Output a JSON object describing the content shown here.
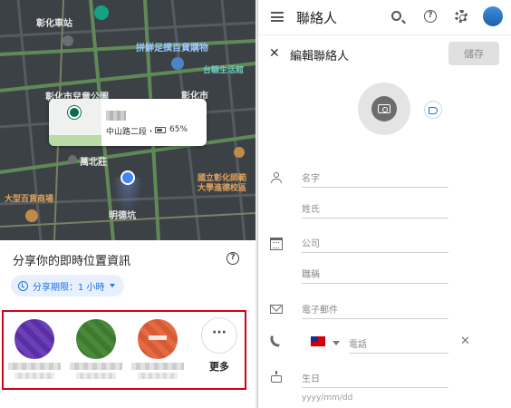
{
  "map": {
    "labels": {
      "changhua_station": "彰化車站",
      "shopping": "拼鮮足撲百貨購物",
      "taisugar": "台糖生活館",
      "children_park": "彰化市兒童公園",
      "changhua_city": "彰化市",
      "wanbei": "萬北莊",
      "university": "國立彰化師範大學進德校區",
      "minde": "明德坑",
      "mall": "大型百貨商場"
    },
    "card": {
      "address": "中山路二段・",
      "battery": "65%"
    }
  },
  "share": {
    "title": "分享你的即時位置資訊",
    "duration": "分享期限：1 小時",
    "more_label": "更多",
    "more_glyph": "···"
  },
  "contacts_app": {
    "title": "聯絡人",
    "edit_title": "編輯聯絡人",
    "save_label": "儲存",
    "close_glyph": "✕",
    "help_glyph": "?",
    "fields": {
      "first_name": "名字",
      "last_name": "姓氏",
      "company": "公司",
      "job_title": "職稱",
      "email": "電子郵件",
      "phone": "電話",
      "birthday": "生日",
      "birthday_hint": "yyyy/mm/dd"
    },
    "clear_glyph": "✕"
  },
  "colors": {
    "accent": "#1a73e8",
    "highlight_box": "#d0021b"
  }
}
